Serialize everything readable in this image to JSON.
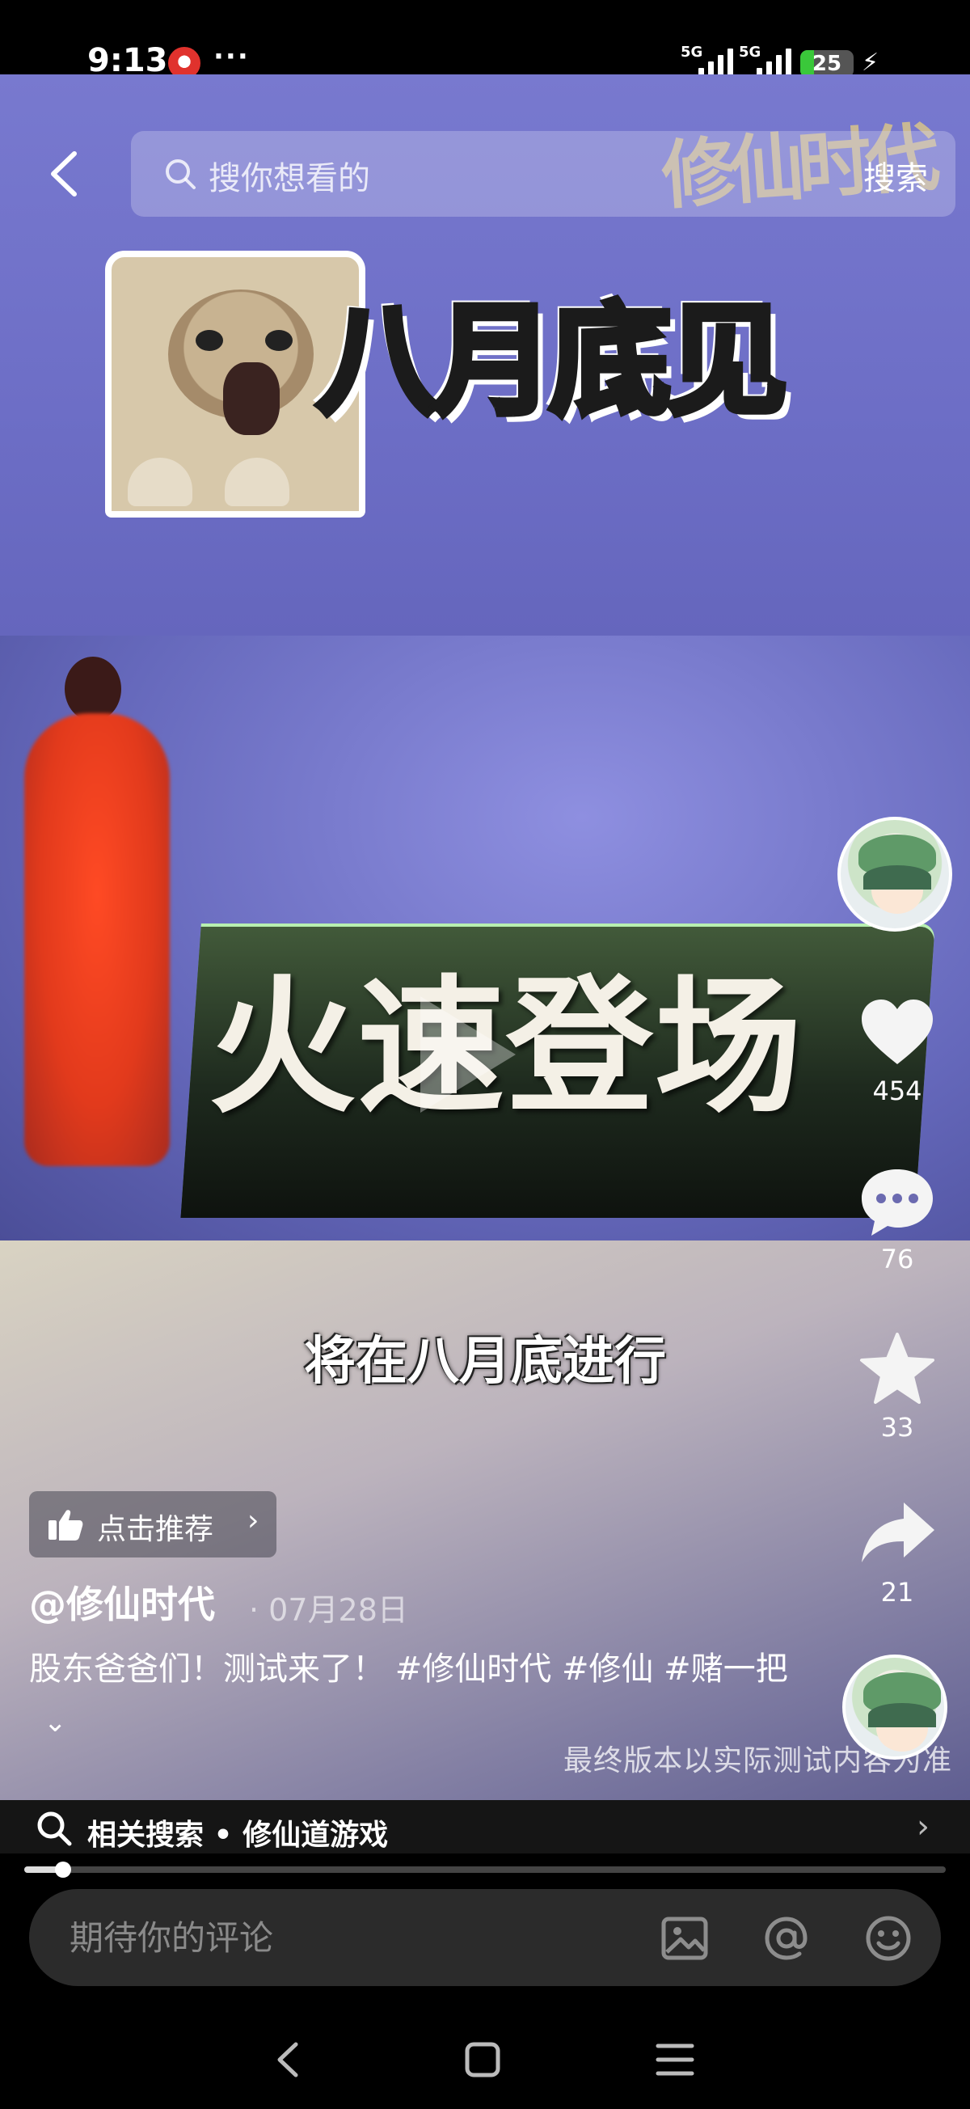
{
  "status_bar": {
    "time": "9:13",
    "more": "···",
    "network_1": "5G",
    "network_2": "5G",
    "battery": "25",
    "battery_level": 0.25
  },
  "search": {
    "placeholder": "搜你想看的",
    "button": "搜索"
  },
  "video": {
    "watermark": "修仙时代",
    "sticker_text": "八月底见",
    "banner_text": "火速登场",
    "subtitle": "将在八月底进行",
    "disclaimer": "最终版本以实际测试内容为准"
  },
  "actions": {
    "likes": "454",
    "comments": "76",
    "favorites": "33",
    "shares": "21"
  },
  "post": {
    "recommend_label": "点击推荐",
    "author": "@修仙时代",
    "date": "· 07月28日",
    "caption": "股东爸爸们！测试来了！ #修仙时代 #修仙 #赌一把",
    "expand_icon": "chevron-down"
  },
  "related": {
    "text": "相关搜索 • 修仙道游戏"
  },
  "playback": {
    "progress": 0.042
  },
  "comment": {
    "placeholder": "期待你的评论"
  }
}
